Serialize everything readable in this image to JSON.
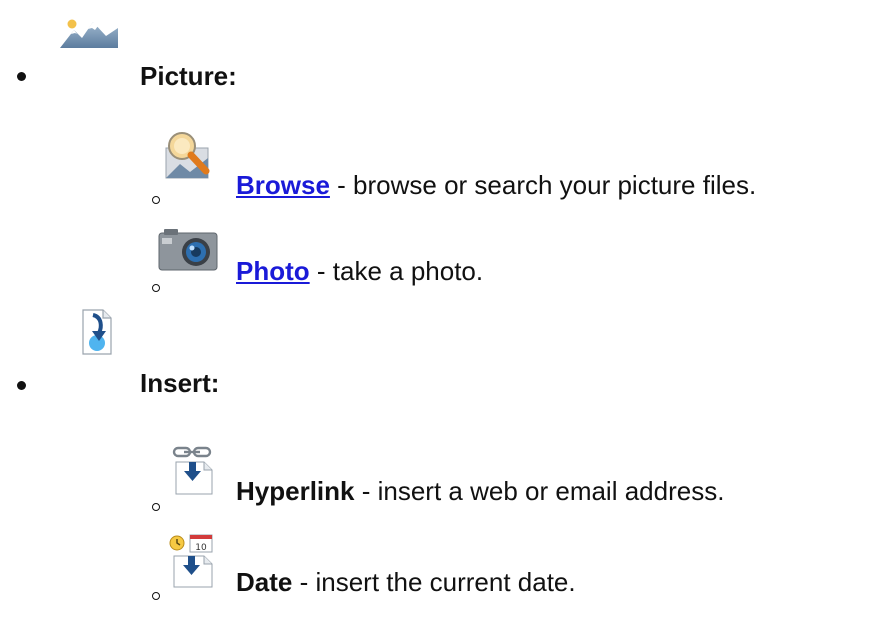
{
  "list": {
    "picture": {
      "icon": "picture-mountain-icon",
      "label": "Picture:",
      "items": [
        {
          "icon": "browse-magnifier-icon",
          "link_text": "Browse",
          "description": " - browse or search your picture files."
        },
        {
          "icon": "camera-icon",
          "link_text": "Photo",
          "description": " - take a photo."
        }
      ]
    },
    "insert": {
      "icon": "insert-document-arrow-icon",
      "label": "Insert:",
      "items": [
        {
          "icon": "hyperlink-chain-icon",
          "term": "Hyperlink",
          "description": " - insert a web or email address."
        },
        {
          "icon": "date-calendar-icon",
          "term": "Date",
          "description": " - insert the current date.",
          "calendar_number": "10"
        }
      ]
    }
  },
  "colors": {
    "link": "#1a1ad8",
    "text": "#111111"
  }
}
